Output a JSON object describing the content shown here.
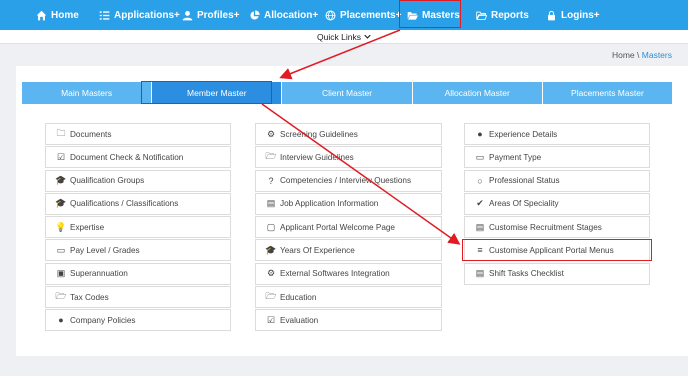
{
  "nav": {
    "home": "Home",
    "applications": "Applications+",
    "profiles": "Profiles+",
    "allocation": "Allocation+",
    "placements": "Placements+",
    "masters": "Masters",
    "reports": "Reports",
    "logins": "Logins+"
  },
  "quick_links": "Quick Links",
  "breadcrumb": {
    "home": "Home",
    "sep": "\\",
    "current": "Masters"
  },
  "tabs": [
    "Main Masters",
    "Member Master",
    "Client Master",
    "Allocation Master",
    "Placements Master"
  ],
  "col1": [
    {
      "icon": "folder-icon",
      "label": "Documents"
    },
    {
      "icon": "checkbox-icon",
      "label": "Document Check & Notification"
    },
    {
      "icon": "graduation-cap-icon",
      "label": "Qualification Groups"
    },
    {
      "icon": "graduation-cap-icon",
      "label": "Qualifications / Classifications"
    },
    {
      "icon": "lightbulb-icon",
      "label": "Expertise"
    },
    {
      "icon": "credit-card-icon",
      "label": "Pay Level / Grades"
    },
    {
      "icon": "money-icon",
      "label": "Superannuation"
    },
    {
      "icon": "folder-open-icon",
      "label": "Tax Codes"
    },
    {
      "icon": "check-circle-icon",
      "label": "Company Policies"
    }
  ],
  "col2": [
    {
      "icon": "cogs-icon",
      "label": "Screening Guidelines"
    },
    {
      "icon": "folder-open-icon",
      "label": "Interview Guidelines"
    },
    {
      "icon": "question-circle-icon",
      "label": "Competencies / Interview Questions"
    },
    {
      "icon": "briefcase-icon",
      "label": "Job Application Information"
    },
    {
      "icon": "comment-icon",
      "label": "Applicant Portal Welcome Page"
    },
    {
      "icon": "graduation-cap-icon",
      "label": "Years Of Experience"
    },
    {
      "icon": "gear-icon",
      "label": "External Softwares Integration"
    },
    {
      "icon": "folder-open-icon",
      "label": "Education"
    },
    {
      "icon": "checkbox-checked-icon",
      "label": "Evaluation"
    }
  ],
  "col3": [
    {
      "icon": "user-icon",
      "label": "Experience Details"
    },
    {
      "icon": "payment-icon",
      "label": "Payment Type"
    },
    {
      "icon": "user-outline-icon",
      "label": "Professional Status"
    },
    {
      "icon": "check-icon",
      "label": "Areas Of Speciality"
    },
    {
      "icon": "briefcase-icon",
      "label": "Customise Recruitment Stages"
    },
    {
      "icon": "list-icon",
      "label": "Customise Applicant Portal Menus"
    },
    {
      "icon": "briefcase-icon",
      "label": "Shift Tasks Checklist"
    }
  ],
  "colors": {
    "nav_bg": "#2aa0e8",
    "tab_bg": "#5bb5f0",
    "tab_active": "#2b8ee0",
    "highlight": "#e01b24"
  }
}
